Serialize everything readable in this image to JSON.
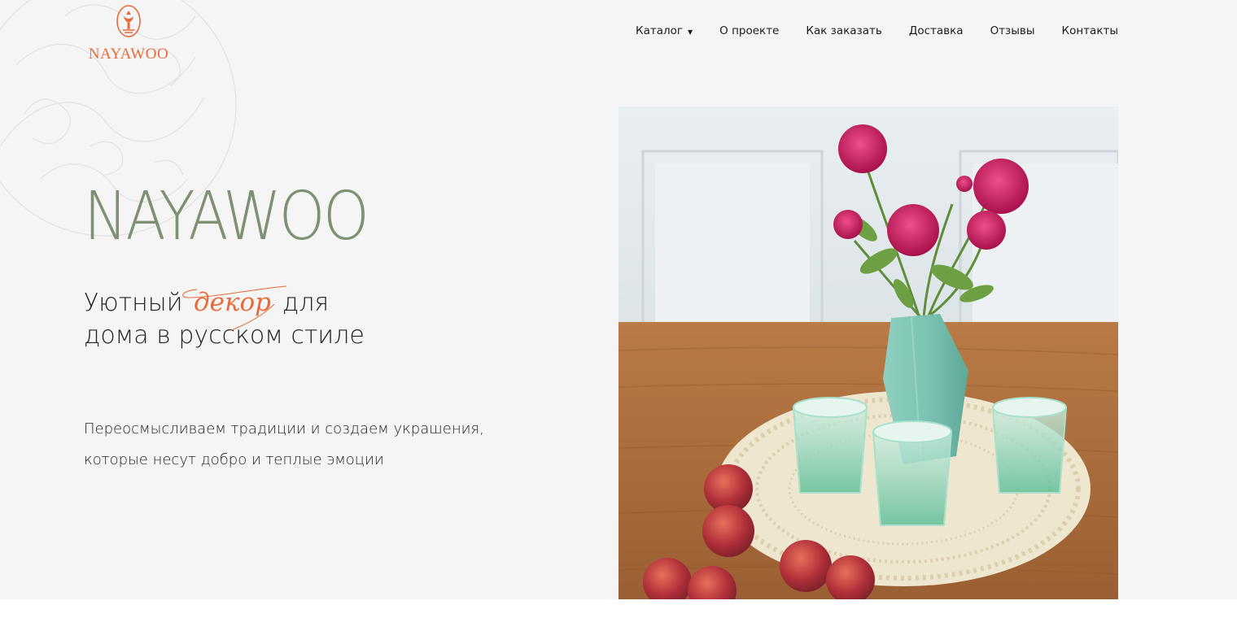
{
  "header": {
    "logo_text": "NAYAWOO",
    "nav": [
      {
        "label": "Каталог",
        "has_dropdown": true
      },
      {
        "label": "О проекте"
      },
      {
        "label": "Как заказать"
      },
      {
        "label": "Доставка"
      },
      {
        "label": "Отзывы"
      },
      {
        "label": "Контакты"
      }
    ]
  },
  "hero": {
    "title": "NAYAWOO",
    "tagline_start": "Уютный",
    "tagline_accent": "декор",
    "tagline_end": "для",
    "tagline_line2": "дома в русском стиле",
    "description_line1": "Переосмысливаем традиции и создаем украшения,",
    "description_line2": "которые несут добро и теплые эмоции"
  },
  "colors": {
    "accent": "#e86a3a",
    "title_green": "#7f9173",
    "background": "#f5f5f5"
  },
  "icons": [
    "logo-emblem-icon",
    "caret-down-icon",
    "decorative-ornament"
  ]
}
